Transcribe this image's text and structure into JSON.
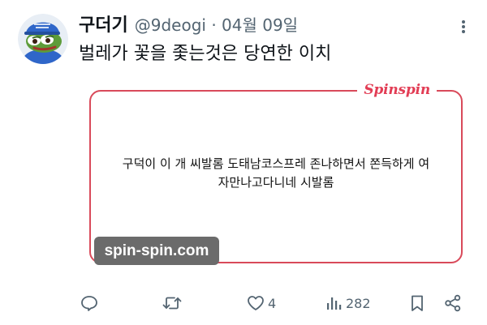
{
  "tweet": {
    "display_name": "구더기",
    "handle": "@9deogi",
    "separator": "·",
    "date": "04월 09일",
    "text": "벌레가 꽃을 좇는것은 당연한 이치"
  },
  "card": {
    "logo": "Spinspin",
    "text_line1": "구덕이 이 개 씨발롬 도태남코스프레 존나하면서 쫀득하게 여",
    "text_line2": "자만나고다니네 시발롬",
    "border_color": "#d94a5a"
  },
  "watermark": {
    "text": "spin-spin.com"
  },
  "actions": {
    "reply_icon": "reply-icon",
    "retweet_icon": "retweet-icon",
    "like_icon": "heart-icon",
    "like_count": "4",
    "views_icon": "views-icon",
    "views_count": "282",
    "bookmark_icon": "bookmark-icon",
    "share_icon": "share-icon"
  },
  "colors": {
    "text_primary": "#0f1419",
    "text_secondary": "#536471",
    "brand_red": "#e23d55"
  }
}
